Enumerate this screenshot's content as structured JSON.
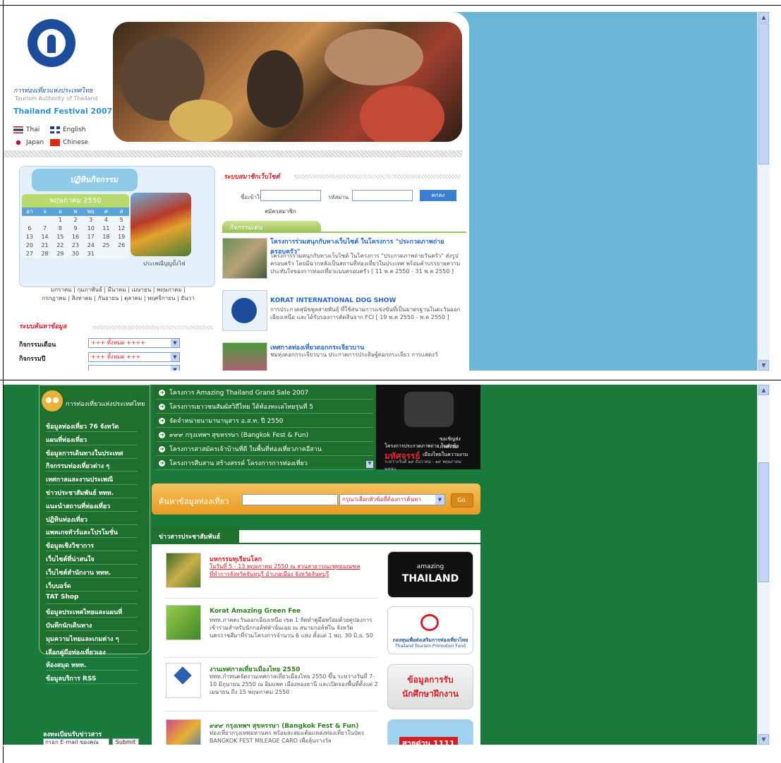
{
  "site": {
    "org_thai": "การท่องเที่ยวแห่งประเทศไทย",
    "org_en": "Tourism Authority of Thailand",
    "festival": "Thailand Festival 2007",
    "languages": [
      "Thai",
      "English",
      "Japan",
      "Chinese"
    ]
  },
  "calendar": {
    "title": "ปฏิทินกิจกรรม",
    "month": "พฤษภาคม 2550",
    "day_headers": [
      "อา",
      "จ",
      "อ",
      "พ",
      "พฤ",
      "ศ",
      "ส"
    ],
    "days": [
      "",
      "",
      "1",
      "2",
      "3",
      "4",
      "5",
      "6",
      "7",
      "8",
      "9",
      "10",
      "11",
      "12",
      "13",
      "14",
      "15",
      "16",
      "17",
      "18",
      "19",
      "20",
      "21",
      "22",
      "23",
      "24",
      "25",
      "26",
      "27",
      "28",
      "29",
      "30",
      "31",
      "",
      ""
    ],
    "photo_caption": "ประเพณีบุญบั้งไฟ",
    "months_line1": "มกราคม | กุมภาพันธ์ | มีนาคม | เมษายน | พฤษภาคม |",
    "months_line2": "กรกฎาคม | สิงหาคม | กันยายน | ตุลาคม | พฤศจิกายน | ธันวา"
  },
  "activity_search": {
    "title": "ระบบค้นหาข้อมูล",
    "rows": [
      {
        "label": "กิจกรรมเดือน",
        "value": "+++ ทั้งหมด ++++"
      },
      {
        "label": "กิจกรรมปี",
        "value": "+++ ทั้งหมด +++"
      }
    ]
  },
  "login": {
    "title": "ระบบสมาชิกเว็บไซต์",
    "user_label": "ชื่อเข้าใช้",
    "pass_label": "รหัสผ่าน",
    "submit": "ตกลง",
    "register": "สมัครสมาชิก"
  },
  "activities": {
    "tab": "กิจกรรมเด่น",
    "items": [
      {
        "title": "โครงการร่วมสนุกกับทางเว็บไซต์ ในโครงการ \"ประกวดภาพถ่ายครอบครัว\"",
        "body": "โครงการร่วมสนุกกับทางเว็บไซต์ ในโครงการ \"ประกวดภาพถ่ายวันครัว\" ส่งรูปครอบครัว โดยมีฉากหลังเป็นสถานที่ท่องเที่ยวในประเทศ พร้อมคำบรรยายความประทับใจของการท่องเที่ยวแบบครอบครัว [ 11 พ.ค 2550 - 31 พ.ค 2550 ]"
      },
      {
        "title": "KORAT INTERNATIONAL DOG SHOW",
        "body": "การประกวดสุนัขพูลสายพันธุ์ ที่ใช้สนามการแข่งขันที่เป็นมาตรฐานในตะวันออกเฉียงเหนือ และได้รับรองการตัดสินจาก FCI [ 19 พ.ค 2550 - พ.ค 2550 ]"
      },
      {
        "title": "เทศกาลท่องเที่ยวดอกกระเจียวบาน",
        "body": "ชมทุ่งดอกกระเจียวบาน ประกวดการประดิษฐ์ดอกกระเจียว การแสดงวั"
      }
    ]
  },
  "sidebar": {
    "title": "การท่องเที่ยวแห่งประเทศไทย",
    "items": [
      "ข้อมูลท่องเที่ยว 76 จังหวัด",
      "แผนที่ท่องเที่ยว",
      "ข้อมูลการเดินทางในประเทศ",
      "กิจกรรมท่องเที่ยวต่าง ๆ",
      "เทศกาลและงานประเพณี",
      "ข่าวประชาสัมพันธ์ ททท.",
      "แนะนำสถานที่ท่องเที่ยว",
      "ปฏิทินท่องเที่ยว",
      "แพคเกจทัวร์และโปรโมชั่น",
      "ข้อมูลเชิงวิชาการ",
      "เว็บไซต์ที่น่าสนใจ",
      "เว็บไซต์สำนักงาน ททท.",
      "เว็บบอร์ด",
      "TAT Shop",
      "ข้อมูลประเทศไทยและแผนที่",
      "บันทึกนักเดินทาง",
      "มุมความไทยและเกมต่าง ๆ",
      "เลือกคู่มือท่องเที่ยวเอง",
      "ห้องสมุด ททท.",
      "ข้อมูลบริการ RSS"
    ],
    "subscribe_title": "ลงทะเบียนรับข่าวสาร",
    "subscribe_placeholder": "กรอก E-mail ของคุณ",
    "subscribe_button": "Submit"
  },
  "projects": [
    "โครงการ Amazing Thailand Grand Sale 2007",
    "โครงการเยาวชนสัมผัสวิถีไทย ใต้ท้องทะเลไทยรุ่นที่ 5",
    "จัดจำหน่ายนามานานุสาร อ.ส.ท. ปี 2550",
    "๙๙๙ กรุงเทพฯ สุขหรรษา (Bangkok Fest & Fun)",
    "โครงการสาสมัครเจ้าบ้านที่ดี ในพื้นที่ท่องเที่ยวภาคอีสาน",
    "โครงการสืบสาน สร้างสรรค์ โครงการการท่องเที่ยว"
  ],
  "promo": {
    "t1": "ขอเชิญส่งภาพร่วม",
    "t2": "โครงการประกวดภาพถ่าย ในหัวข้อ",
    "brand": "มหัศจรรย์",
    "t3": "เมืองไทยในความงาม",
    "t4": "ระหว่างวันที่ ๑๙ ธันวาคม - ๑๙ พฤษภาคม ๒๕๕๐"
  },
  "search2": {
    "title": "ค้นหาข้อมูลท่องเที่ยว",
    "select": "กรุณาเลือกหัวข้อที่ต้องการค้นหา",
    "go": "Go."
  },
  "press": {
    "tab": "ข่าวสารประชาสัมพันธ์",
    "items": [
      {
        "title": "มหกรรมทุเรียนโลก",
        "body": "ในวันที่ 5 - 13 พฤษภาคม 2550 ณ สวนสาธารณะพุทธมณฑลที่ทำการจังหวัดจันทบุรี อำเภอเมือง จังหวัดจันทบุรี",
        "red": true
      },
      {
        "title": "Korat Amazing Green Fee",
        "body": "ททท.ภาคตะวันออกเฉียงเหนือ เขต 1 จัดทำคู่มือพร้อมด้วยคูปองการเข้าร่วมสำหรับนักกอล์ฟฟ่านั่นเฉย ณ สนามกอล์ฟใน จังหวัดนครราชสีมาที่ร่วมโครงการจำนวน 6 แห่ง ตั้งแต่ 1 พฤ. 30 มิ.ย. 50",
        "red": false
      },
      {
        "title": "งานเทศกาลเที่ยวเมืองไทย 2550",
        "body": "ททท.กำหนดจัดงานเทศกาลเที่ยวเมืองไทย 2550 ขึ้น ระหว่างวันที่ 7-10 มิถุนายน 2550 ณ อิมแพค เมืองทองธานี และเปิดจองพื้นที่ตั้งแต่ 2 เมษายน ถึง 15 พฤษภาคม 2550",
        "red": false
      },
      {
        "title": "๙๙๙ กรุงเทพฯ สุขหรรษา (Bangkok Fest & Fun)",
        "body": "ท่องเที่ยวกรุงเทพมหานคร พร้อมสะสมแต้มแหล่งท่องเที่ยวในบัตร BANGKOK FEST MILEAGE CARD เพื่อลุ้นรางวัล",
        "red": false
      }
    ]
  },
  "ads": {
    "amazing_top": "amazing",
    "amazing_bottom": "THAILAND",
    "fund_name": "กองทุนเพื่อส่งเสริมการท่องเที่ยวไทย",
    "fund_en": "Thailand Tourism Promotion Fund",
    "intern_line1": "ข้อมูลการรับ",
    "intern_line2": "นักศึกษาฝึกงาน",
    "hotline": "สายด่วน 1111"
  },
  "colors": {
    "sky": "#6ab6d6",
    "green": "#1a7a3c",
    "tat_blue": "#1d4d9a",
    "red": "#d0202a"
  }
}
